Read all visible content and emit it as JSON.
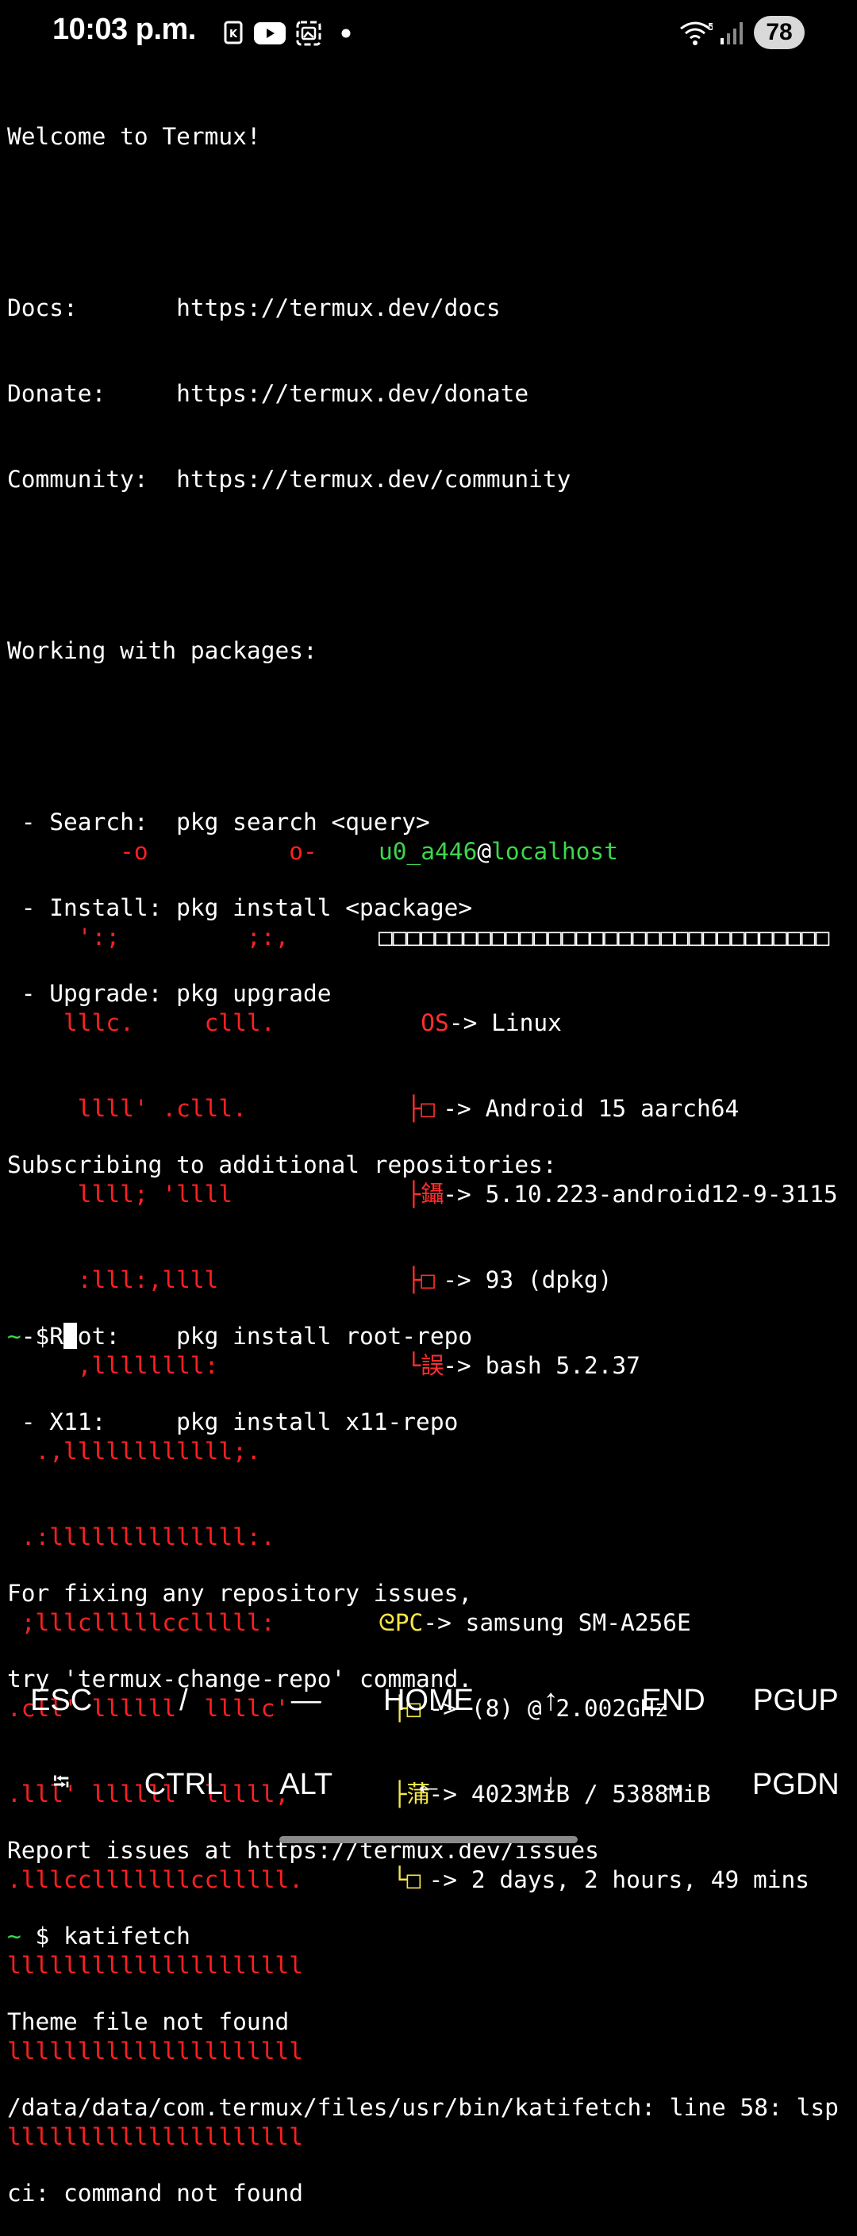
{
  "status_bar": {
    "time": "10:03 p.m.",
    "battery": "78",
    "wifi_badge": "5",
    "icons": [
      "sim-card-icon",
      "youtube-icon",
      "gallery-icon",
      "notification-dot-icon",
      "wifi-icon",
      "signal-icon",
      "battery-icon"
    ]
  },
  "terminal": {
    "welcome": "Welcome to Termux!",
    "docs_label": "Docs:       ",
    "docs_url": "https://termux.dev/docs",
    "donate_label": "Donate:     ",
    "donate_url": "https://termux.dev/donate",
    "community_label": "Community:  ",
    "community_url": "https://termux.dev/community",
    "packages_header": "Working with packages:",
    "pkg_search": " - Search:  pkg search <query>",
    "pkg_install": " - Install: pkg install <package>",
    "pkg_upgrade": " - Upgrade: pkg upgrade",
    "repos_header": "Subscribing to additional repositories:",
    "repo_root": " - Root:    pkg install root-repo",
    "repo_x11": " - X11:     pkg install x11-repo",
    "fix_line1": "For fixing any repository issues,",
    "fix_line2": "try 'termux-change-repo' command.",
    "report": "Report issues at https://termux.dev/issues",
    "prompt_symbol": "~",
    "prompt_dollar": " $ ",
    "command": "katifetch",
    "error1": "Theme file not found",
    "error2": "/data/data/com.termux/files/usr/bin/katifetch: line 58: lsp",
    "error3": "ci: command not found"
  },
  "ascii_art": [
    "        -o          o-",
    "     ':;         ;:,",
    "    lllc.     clll.",
    "     llll' .clll.",
    "     llll; 'llll",
    "     :lll:,llll",
    "     ,llllllll:",
    "  .,llllllllllll;.",
    " .:llllllllllllll:.",
    " ;lllclllllcclllll:",
    ".cll' llllll  llllc'",
    ".lll' llllll  lllll,",
    ".lllcclllllllcclllll.",
    "lllllllllllllllllllll",
    "lllllllllllllllllllll",
    "lllllllllllllllllllll"
  ],
  "fetch": {
    "user": "u0_a446",
    "at": "@",
    "host": "localhost",
    "separator": "□□□□□□□□□□□□□□□□□□□□□□□□□□□□□□□□",
    "os_label": "OS",
    "os_value": "-> Linux",
    "rows_top": [
      {
        "glyph": "├□",
        "value": "-> Android 15 aarch64"
      },
      {
        "glyph": "├鑷",
        "value": "-> 5.10.223-android12-9-3115"
      },
      {
        "glyph": "├□",
        "value": "-> 93 (dpkg)"
      },
      {
        "glyph": "└誤",
        "value": "-> bash 5.2.37"
      }
    ],
    "pc_glyph": "ᘓ",
    "pc_label": "PC",
    "pc_value": "-> samsung SM-A256E",
    "rows_bottom": [
      {
        "glyph": "├□",
        "value": "-> (8) @ 2.002GHz"
      },
      {
        "glyph": "├蒲",
        "value": "-> 4023MiB / 5388MiB"
      },
      {
        "glyph": "└□",
        "value": "-> 2 days, 2 hours, 49 mins"
      }
    ]
  },
  "prompt2": {
    "symbol": "~",
    "dollar": " $ "
  },
  "extra_keys": {
    "row1": [
      "ESC",
      "/",
      "—",
      "HOME",
      "↑",
      "END",
      "PGUP"
    ],
    "row2": [
      "⭾",
      "CTRL",
      "ALT",
      "←",
      "↓",
      "→",
      "PGDN"
    ]
  }
}
